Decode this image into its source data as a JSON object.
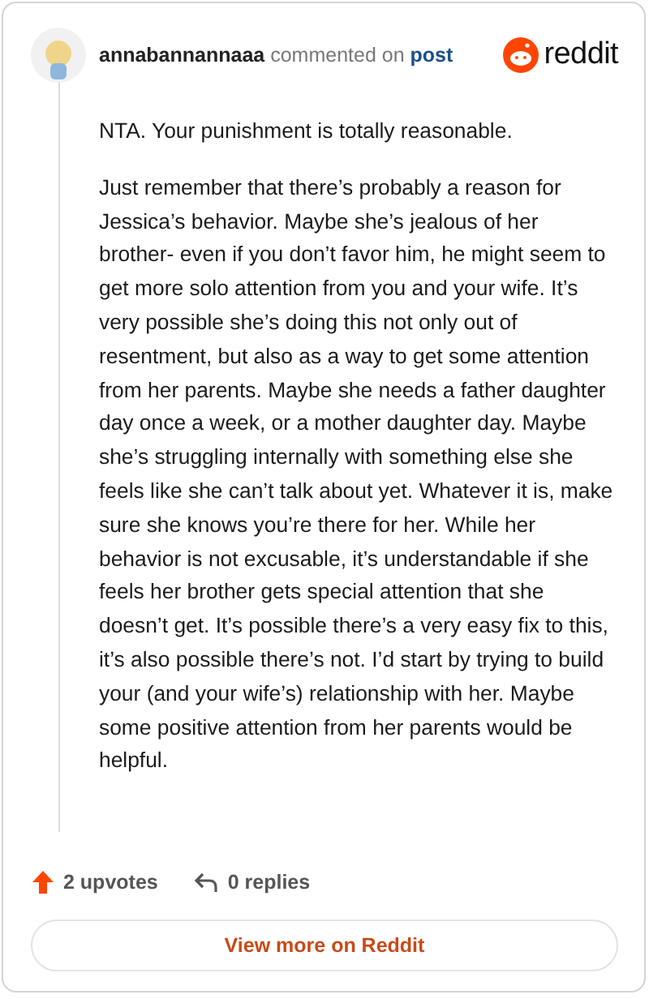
{
  "comment": {
    "author": "annabannannaaa",
    "action": "commented on",
    "link": "post",
    "paragraphs": [
      "NTA. Your punishment is totally reasonable.",
      "Just remember that there’s probably a reason for Jessica’s behavior. Maybe she’s jealous of her brother- even if you don’t favor him, he might seem to get more solo attention from you and your wife. It’s very possible she’s doing this not only out of resentment, but also as a way to get some attention from her parents. Maybe she needs a father daughter day once a week, or a mother daughter day. Maybe she’s struggling internally with something else she feels like she can’t talk about yet. Whatever it is, make sure she knows you’re there for her. While her behavior is not excusable, it’s understandable if she feels her brother gets special attention that she doesn’t get. It’s possible there’s a very easy fix to this, it’s also possible there’s not. I’d start by trying to build your (and your wife’s) relationship with her. Maybe some positive attention from her parents would be helpful."
    ],
    "upvotes": "2 upvotes",
    "replies": "0 replies"
  },
  "brand": "reddit",
  "button": "View more on Reddit"
}
